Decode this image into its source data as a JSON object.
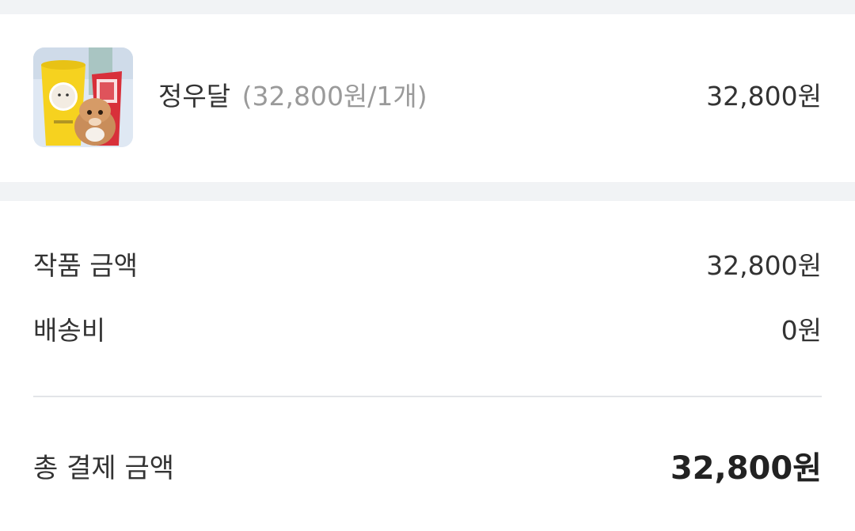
{
  "product": {
    "name": "정우달",
    "detail": "(32,800원/1개)",
    "price": "32,800원",
    "image_alt": "product-thumbnail"
  },
  "summary": {
    "product_amount_label": "작품 금액",
    "product_amount_value": "32,800원",
    "shipping_label": "배송비",
    "shipping_value": "0원",
    "total_label": "총 결제 금액",
    "total_value": "32,800원"
  },
  "colors": {
    "section_gap": "#f1f3f5",
    "text_primary": "#333333",
    "text_secondary": "#9a9a9a",
    "divider": "#e3e5e8"
  }
}
